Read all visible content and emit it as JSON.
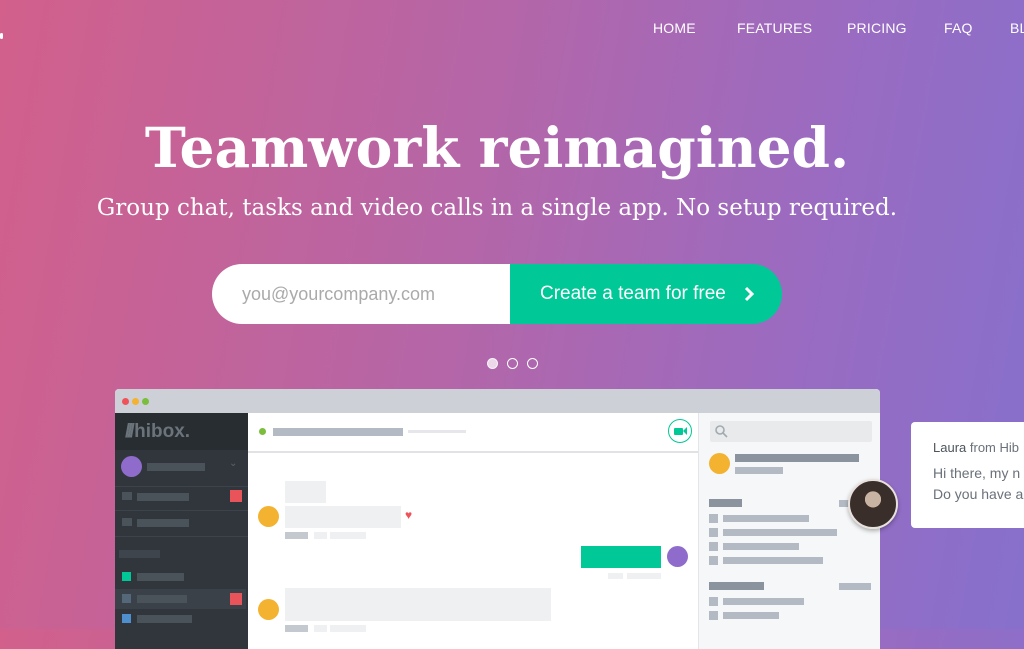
{
  "nav": {
    "items": [
      "HOME",
      "FEATURES",
      "PRICING",
      "FAQ",
      "BL"
    ]
  },
  "hero": {
    "title": "Teamwork reimagined.",
    "subtitle": "Group chat, tasks and video calls in a single app. No setup required.",
    "email_placeholder": "you@yourcompany.com",
    "cta_label": "Create a team for free",
    "carousel_active": 1,
    "carousel_count": 3
  },
  "app": {
    "logo": "hibox."
  },
  "chat_popup": {
    "agent_name": "Laura",
    "agent_from": "from Hib",
    "line1": "Hi there, my n",
    "line2": "Do you have a"
  },
  "colors": {
    "accent": "#00c896",
    "gradient_start": "#d2608b",
    "gradient_end": "#8670cc"
  }
}
